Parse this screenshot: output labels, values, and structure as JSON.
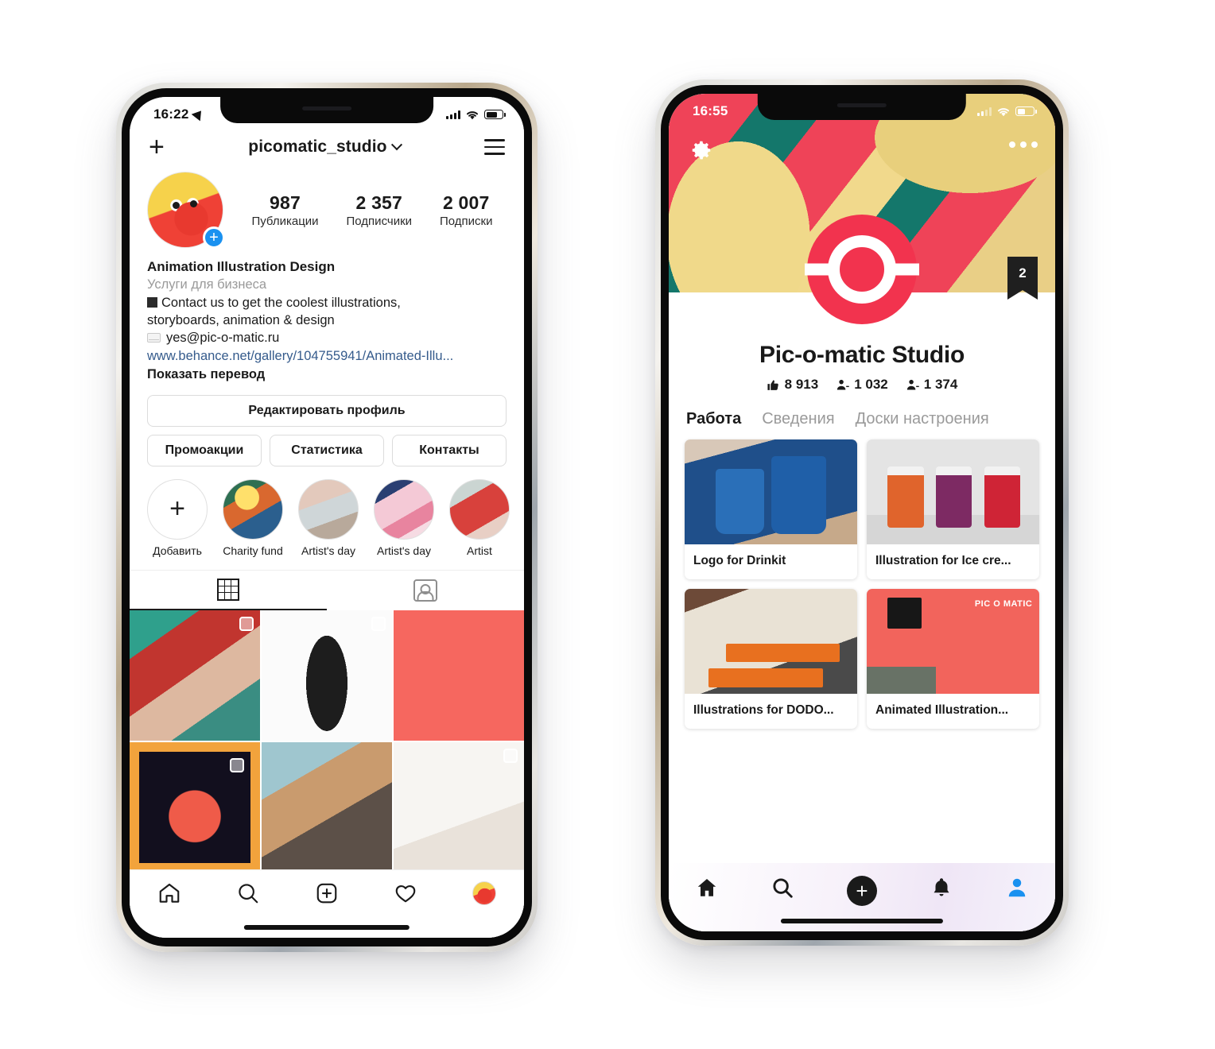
{
  "left_phone": {
    "app": "Instagram",
    "status_bar": {
      "time": "16:22",
      "location_icon": "location-arrow-icon",
      "signal_icon": "cellular-signal-icon",
      "wifi_icon": "wifi-icon",
      "battery_icon": "battery-icon"
    },
    "top_bar": {
      "add_icon": "plus-icon",
      "username": "picomatic_studio",
      "chevron_icon": "chevron-down-icon",
      "menu_icon": "hamburger-menu-icon"
    },
    "profile": {
      "avatar_icon": "profile-avatar",
      "story_add_icon": "add-story-plus-icon",
      "stats": [
        {
          "number": "987",
          "label": "Публикации"
        },
        {
          "number": "2 357",
          "label": "Подписчики"
        },
        {
          "number": "2 007",
          "label": "Подписки"
        }
      ]
    },
    "bio": {
      "name": "Animation Illustration Design",
      "category": "Услуги для бизнеса",
      "line1": "Contact us to get the coolest illustrations,",
      "line2": "storyboards, animation & design",
      "email": "yes@pic-o-matic.ru",
      "link": "www.behance.net/gallery/104755941/Animated-Illu...",
      "translate": "Показать перевод"
    },
    "buttons": {
      "edit_profile": "Редактировать профиль",
      "promotions": "Промоакции",
      "statistics": "Статистика",
      "contacts": "Контакты"
    },
    "highlights": [
      {
        "label": "Добавить",
        "icon": "plus-icon"
      },
      {
        "label": "Charity fund",
        "icon": "highlight-thumb"
      },
      {
        "label": "Artist's day",
        "icon": "highlight-thumb"
      },
      {
        "label": "Artist's day",
        "icon": "highlight-thumb"
      },
      {
        "label": "Artist",
        "icon": "highlight-thumb"
      }
    ],
    "tabs": [
      {
        "name": "grid-tab",
        "icon": "grid-icon",
        "active": true
      },
      {
        "name": "tagged-tab",
        "icon": "tagged-person-icon",
        "active": false
      }
    ],
    "bottom_nav": [
      {
        "name": "home",
        "icon": "home-icon"
      },
      {
        "name": "search",
        "icon": "search-icon"
      },
      {
        "name": "create",
        "icon": "plus-square-icon"
      },
      {
        "name": "activity",
        "icon": "heart-icon"
      },
      {
        "name": "profile",
        "icon": "profile-avatar-icon"
      }
    ]
  },
  "right_phone": {
    "app": "Behance",
    "status_bar": {
      "time": "16:55",
      "signal_icon": "cellular-signal-icon",
      "wifi_icon": "wifi-icon",
      "battery_icon": "battery-icon"
    },
    "cover": {
      "settings_icon": "gear-icon",
      "more_icon": "more-options-icon",
      "logo_icon": "pic-o-matic-logo",
      "bookmark_badge": "2"
    },
    "profile": {
      "title": "Pic-o-matic Studio",
      "stats": [
        {
          "icon": "thumbs-up-icon",
          "value": "8 913"
        },
        {
          "icon": "followers-icon",
          "value": "1 032"
        },
        {
          "icon": "following-icon",
          "value": "1 374"
        }
      ]
    },
    "tabs": [
      {
        "label": "Работа",
        "active": true
      },
      {
        "label": "Сведения",
        "active": false
      },
      {
        "label": "Доски настроения",
        "active": false
      }
    ],
    "cards": [
      {
        "title": "Logo for Drinkit",
        "thumb": "drinkit-cups-photo"
      },
      {
        "title": "Illustration for Ice cre...",
        "thumb": "ice-cream-cups-photo"
      },
      {
        "title": "Illustrations for DODO...",
        "thumb": "dodo-pizza-boxes-photo"
      },
      {
        "title": "Animated Illustration...",
        "thumb": "pic-o-matic-illustration"
      }
    ],
    "bottom_nav": [
      {
        "name": "home",
        "icon": "home-icon"
      },
      {
        "name": "search",
        "icon": "search-icon"
      },
      {
        "name": "create",
        "icon": "plus-circle-icon"
      },
      {
        "name": "notifications",
        "icon": "bell-icon"
      },
      {
        "name": "profile",
        "icon": "person-icon"
      }
    ]
  },
  "colors": {
    "instagram_blue": "#1a91f0",
    "behance_red": "#f2334e",
    "behance_active_nav": "#1a91f0",
    "link_blue": "#355b8c"
  }
}
